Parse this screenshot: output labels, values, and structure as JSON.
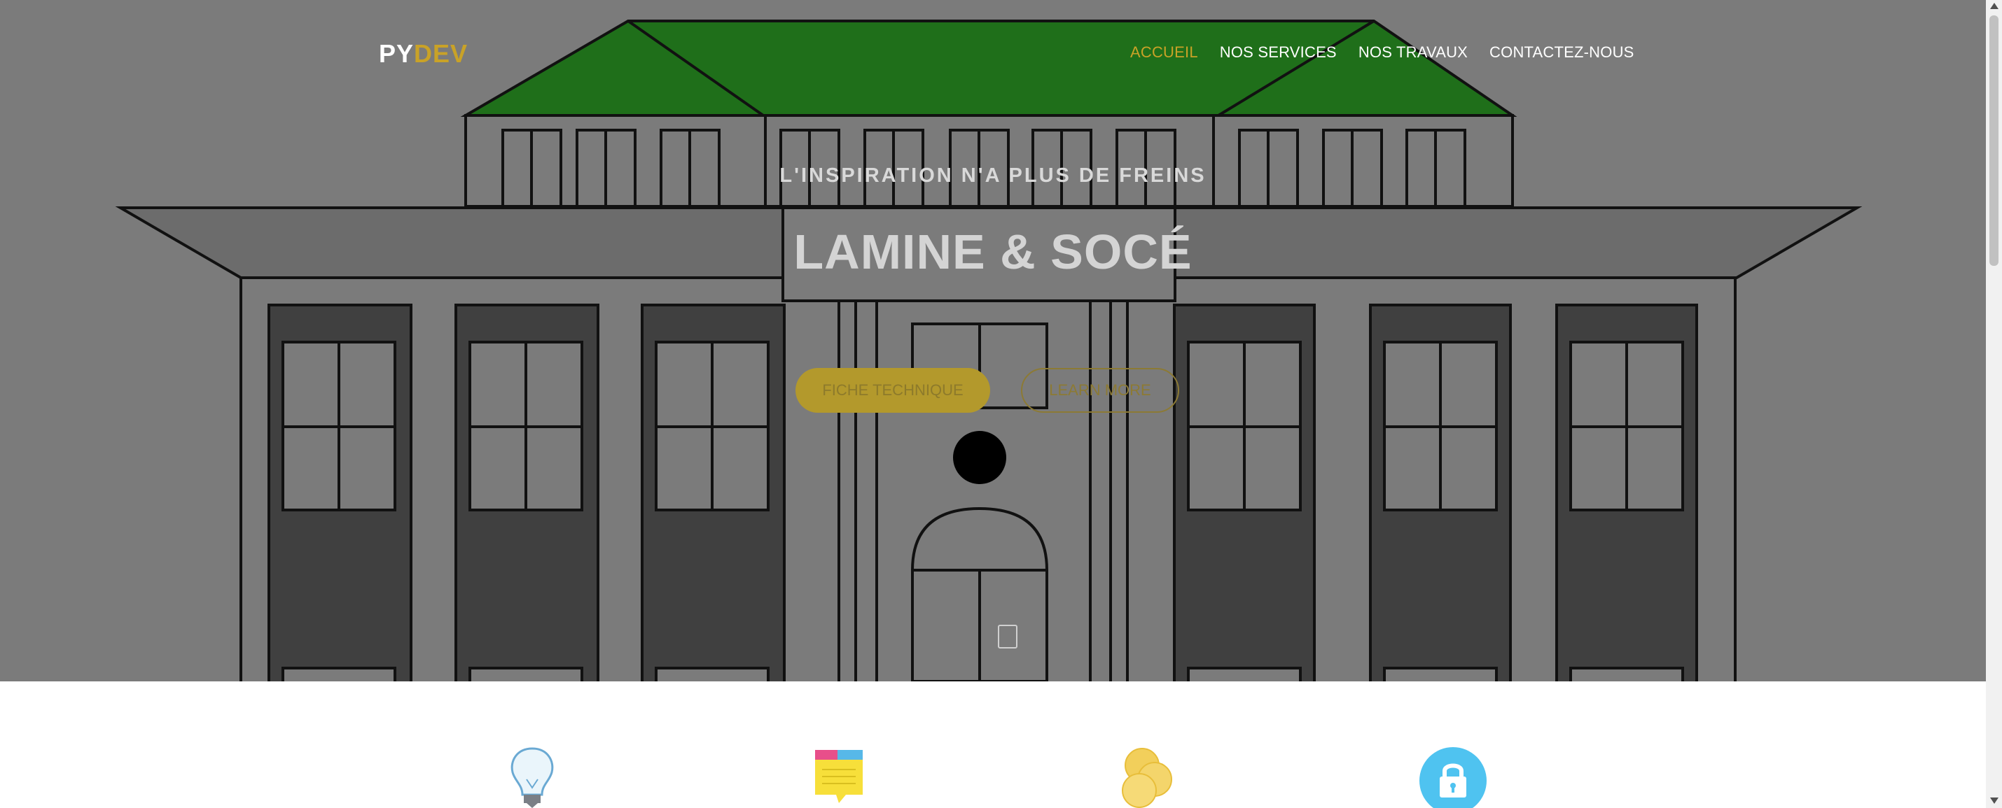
{
  "brand": {
    "part1": "PY",
    "part2": "DEV",
    "accent_color": "#c9a227"
  },
  "nav": {
    "items": [
      {
        "label": "ACCUEIL",
        "active": true
      },
      {
        "label": "NOS SERVICES",
        "active": false
      },
      {
        "label": "NOS TRAVAUX",
        "active": false
      },
      {
        "label": "CONTACTEZ-NOUS",
        "active": false
      }
    ]
  },
  "hero": {
    "tagline": "L'INSPIRATION N'A PLUS DE FREINS",
    "title": "LAMINE & SOCÉ",
    "primary_button": "FICHE TECHNIQUE",
    "secondary_button": "LEARN MORE"
  },
  "features": {
    "icons": [
      "lightbulb-icon",
      "sticky-note-icon",
      "coins-icon",
      "lock-icon"
    ]
  },
  "colors": {
    "hero_overlay": "#7b7b7b",
    "roof": "#1f6f1a",
    "accent": "#c9a227"
  }
}
